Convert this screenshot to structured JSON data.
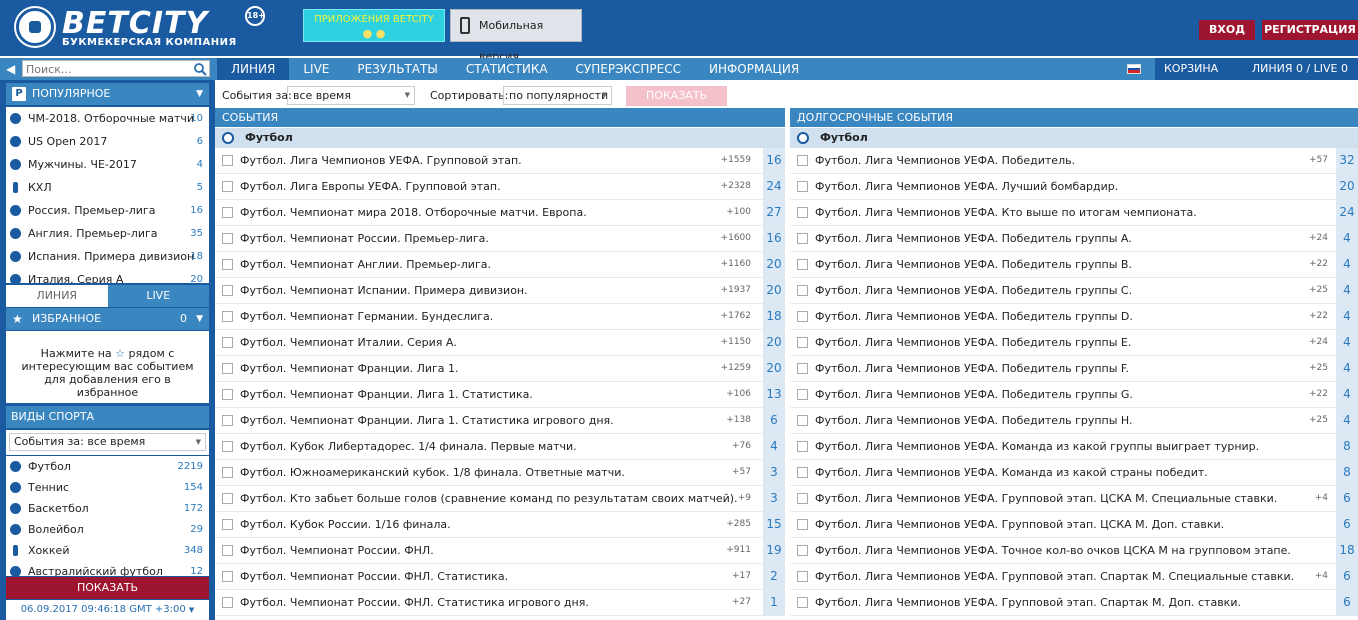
{
  "header": {
    "logo_text": "BETCITY",
    "logo_sub": "БУКМЕКЕРСКАЯ КОМПАНИЯ",
    "age_badge": "18+",
    "apps_label": "ПРИЛОЖЕНИЯ BETCITY",
    "apps_os": "● ●",
    "mobile_label": "Мобильная версия",
    "login_label": "ВХОД",
    "register_label": "РЕГИСТРАЦИЯ"
  },
  "search": {
    "placeholder": "Поиск..."
  },
  "nav": {
    "tabs": [
      {
        "label": "ЛИНИЯ"
      },
      {
        "label": "LIVE"
      },
      {
        "label": "РЕЗУЛЬТАТЫ"
      },
      {
        "label": "СТАТИСТИКА"
      },
      {
        "label": "СУПЕРЭКСПРЕСС"
      },
      {
        "label": "ИНФОРМАЦИЯ"
      }
    ],
    "cart_label": "КОРЗИНА",
    "cart_counts": "ЛИНИЯ 0 / LIVE 0"
  },
  "sidebar": {
    "popular_title": "ПОПУЛЯРНОЕ",
    "popular_icon": "P",
    "popular": [
      {
        "label": "ЧМ-2018. Отборочные матчи",
        "count": "10"
      },
      {
        "label": "US Open 2017",
        "count": "6"
      },
      {
        "label": "Мужчины. ЧЕ-2017",
        "count": "4"
      },
      {
        "label": "КХЛ",
        "count": "5"
      },
      {
        "label": "Россия. Премьер-лига",
        "count": "16"
      },
      {
        "label": "Англия. Премьер-лига",
        "count": "35"
      },
      {
        "label": "Испания. Примера дивизион",
        "count": "18"
      },
      {
        "label": "Италия. Серия А",
        "count": "20"
      }
    ],
    "tab_line": "ЛИНИЯ",
    "tab_live": "LIVE",
    "fav_title": "ИЗБРАННОЕ",
    "fav_count": "0",
    "fav_text_1": "Нажмите на",
    "fav_text_2": "рядом с интересующим вас событием для добавления его в избранное",
    "sports_title": "ВИДЫ СПОРТА",
    "sports_filter": "События за: все время",
    "sports": [
      {
        "label": "Футбол",
        "count": "2219"
      },
      {
        "label": "Теннис",
        "count": "154"
      },
      {
        "label": "Баскетбол",
        "count": "172"
      },
      {
        "label": "Волейбол",
        "count": "29"
      },
      {
        "label": "Хоккей",
        "count": "348"
      },
      {
        "label": "Австралийский футбол",
        "count": "12"
      }
    ],
    "show_label": "ПОКАЗАТЬ",
    "datetime": "06.09.2017 09:46:18 GMT +3:00"
  },
  "filters": {
    "period_label": "События за:",
    "period_value": "все время",
    "sort_label": "Сортировать:",
    "sort_value": "по популярности",
    "show_label": "ПОКАЗАТЬ"
  },
  "events": {
    "title": "СОБЫТИЯ",
    "sport": "Футбол",
    "rows": [
      {
        "label": "Футбол. Лига Чемпионов УЕФА. Групповой этап.",
        "plus": "+1559",
        "count": "16"
      },
      {
        "label": "Футбол. Лига Европы УЕФА. Групповой этап.",
        "plus": "+2328",
        "count": "24"
      },
      {
        "label": "Футбол. Чемпионат мира 2018. Отборочные матчи. Европа.",
        "plus": "+100",
        "count": "27"
      },
      {
        "label": "Футбол. Чемпионат России. Премьер-лига.",
        "plus": "+1600",
        "count": "16"
      },
      {
        "label": "Футбол. Чемпионат Англии. Премьер-лига.",
        "plus": "+1160",
        "count": "20"
      },
      {
        "label": "Футбол. Чемпионат Испании. Примера дивизион.",
        "plus": "+1937",
        "count": "20"
      },
      {
        "label": "Футбол. Чемпионат Германии. Бундеслига.",
        "plus": "+1762",
        "count": "18"
      },
      {
        "label": "Футбол. Чемпионат Италии. Серия А.",
        "plus": "+1150",
        "count": "20"
      },
      {
        "label": "Футбол. Чемпионат Франции. Лига 1.",
        "plus": "+1259",
        "count": "20"
      },
      {
        "label": "Футбол. Чемпионат Франции. Лига 1. Статистика.",
        "plus": "+106",
        "count": "13"
      },
      {
        "label": "Футбол. Чемпионат Франции. Лига 1. Статистика игрового дня.",
        "plus": "+138",
        "count": "6"
      },
      {
        "label": "Футбол. Кубок Либертадорес. 1/4 финала. Первые матчи.",
        "plus": "+76",
        "count": "4"
      },
      {
        "label": "Футбол. Южноамериканский кубок. 1/8 финала. Ответные матчи.",
        "plus": "+57",
        "count": "3"
      },
      {
        "label": "Футбол. Кто забьет больше голов (сравнение команд по результатам своих матчей).",
        "plus": "+9",
        "count": "3"
      },
      {
        "label": "Футбол. Кубок России. 1/16 финала.",
        "plus": "+285",
        "count": "15"
      },
      {
        "label": "Футбол. Чемпионат России. ФНЛ.",
        "plus": "+911",
        "count": "19"
      },
      {
        "label": "Футбол. Чемпионат России. ФНЛ. Статистика.",
        "plus": "+17",
        "count": "2"
      },
      {
        "label": "Футбол. Чемпионат России. ФНЛ. Статистика игрового дня.",
        "plus": "+27",
        "count": "1"
      }
    ]
  },
  "longterm": {
    "title": "ДОЛГОСРОЧНЫЕ СОБЫТИЯ",
    "sport": "Футбол",
    "rows": [
      {
        "label": "Футбол. Лига Чемпионов УЕФА. Победитель.",
        "plus": "+57",
        "count": "32"
      },
      {
        "label": "Футбол. Лига Чемпионов УЕФА. Лучший бомбардир.",
        "plus": "",
        "count": "20"
      },
      {
        "label": "Футбол. Лига Чемпионов УЕФА. Кто выше по итогам чемпионата.",
        "plus": "",
        "count": "24"
      },
      {
        "label": "Футбол. Лига Чемпионов УЕФА. Победитель группы A.",
        "plus": "+24",
        "count": "4"
      },
      {
        "label": "Футбол. Лига Чемпионов УЕФА. Победитель группы B.",
        "plus": "+22",
        "count": "4"
      },
      {
        "label": "Футбол. Лига Чемпионов УЕФА. Победитель группы C.",
        "plus": "+25",
        "count": "4"
      },
      {
        "label": "Футбол. Лига Чемпионов УЕФА. Победитель группы D.",
        "plus": "+22",
        "count": "4"
      },
      {
        "label": "Футбол. Лига Чемпионов УЕФА. Победитель группы E.",
        "plus": "+24",
        "count": "4"
      },
      {
        "label": "Футбол. Лига Чемпионов УЕФА. Победитель группы F.",
        "plus": "+25",
        "count": "4"
      },
      {
        "label": "Футбол. Лига Чемпионов УЕФА. Победитель группы G.",
        "plus": "+22",
        "count": "4"
      },
      {
        "label": "Футбол. Лига Чемпионов УЕФА. Победитель группы H.",
        "plus": "+25",
        "count": "4"
      },
      {
        "label": "Футбол. Лига Чемпионов УЕФА. Команда из какой группы выиграет турнир.",
        "plus": "",
        "count": "8"
      },
      {
        "label": "Футбол. Лига Чемпионов УЕФА. Команда из какой страны победит.",
        "plus": "",
        "count": "8"
      },
      {
        "label": "Футбол. Лига Чемпионов УЕФА. Групповой этап. ЦСКА М. Специальные ставки.",
        "plus": "+4",
        "count": "6"
      },
      {
        "label": "Футбол. Лига Чемпионов УЕФА. Групповой этап. ЦСКА М. Доп. ставки.",
        "plus": "",
        "count": "6"
      },
      {
        "label": "Футбол. Лига Чемпионов УЕФА. Точное кол-во очков ЦСКА М на групповом этапе.",
        "plus": "",
        "count": "18"
      },
      {
        "label": "Футбол. Лига Чемпионов УЕФА. Групповой этап. Спартак М. Специальные ставки.",
        "plus": "+4",
        "count": "6"
      },
      {
        "label": "Футбол. Лига Чемпионов УЕФА. Групповой этап. Спартак М. Доп. ставки.",
        "plus": "",
        "count": "6"
      }
    ]
  },
  "colors": {
    "brand_blue": "#1a5aa0",
    "nav_blue": "#3a86c0",
    "accent_red": "#9e1530",
    "count_blue": "#2a7abf"
  }
}
